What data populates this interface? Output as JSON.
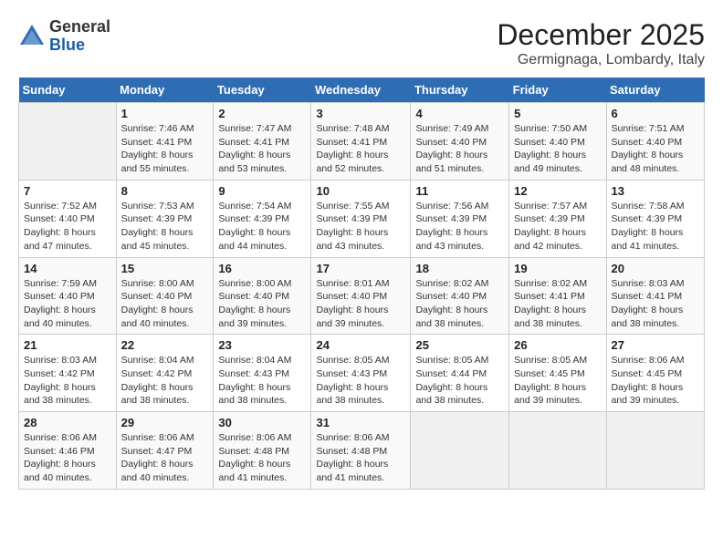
{
  "logo": {
    "general": "General",
    "blue": "Blue"
  },
  "title": "December 2025",
  "subtitle": "Germignaga, Lombardy, Italy",
  "days_header": [
    "Sunday",
    "Monday",
    "Tuesday",
    "Wednesday",
    "Thursday",
    "Friday",
    "Saturday"
  ],
  "weeks": [
    [
      {
        "day": "",
        "info": ""
      },
      {
        "day": "1",
        "info": "Sunrise: 7:46 AM\nSunset: 4:41 PM\nDaylight: 8 hours\nand 55 minutes."
      },
      {
        "day": "2",
        "info": "Sunrise: 7:47 AM\nSunset: 4:41 PM\nDaylight: 8 hours\nand 53 minutes."
      },
      {
        "day": "3",
        "info": "Sunrise: 7:48 AM\nSunset: 4:41 PM\nDaylight: 8 hours\nand 52 minutes."
      },
      {
        "day": "4",
        "info": "Sunrise: 7:49 AM\nSunset: 4:40 PM\nDaylight: 8 hours\nand 51 minutes."
      },
      {
        "day": "5",
        "info": "Sunrise: 7:50 AM\nSunset: 4:40 PM\nDaylight: 8 hours\nand 49 minutes."
      },
      {
        "day": "6",
        "info": "Sunrise: 7:51 AM\nSunset: 4:40 PM\nDaylight: 8 hours\nand 48 minutes."
      }
    ],
    [
      {
        "day": "7",
        "info": "Sunrise: 7:52 AM\nSunset: 4:40 PM\nDaylight: 8 hours\nand 47 minutes."
      },
      {
        "day": "8",
        "info": "Sunrise: 7:53 AM\nSunset: 4:39 PM\nDaylight: 8 hours\nand 45 minutes."
      },
      {
        "day": "9",
        "info": "Sunrise: 7:54 AM\nSunset: 4:39 PM\nDaylight: 8 hours\nand 44 minutes."
      },
      {
        "day": "10",
        "info": "Sunrise: 7:55 AM\nSunset: 4:39 PM\nDaylight: 8 hours\nand 43 minutes."
      },
      {
        "day": "11",
        "info": "Sunrise: 7:56 AM\nSunset: 4:39 PM\nDaylight: 8 hours\nand 43 minutes."
      },
      {
        "day": "12",
        "info": "Sunrise: 7:57 AM\nSunset: 4:39 PM\nDaylight: 8 hours\nand 42 minutes."
      },
      {
        "day": "13",
        "info": "Sunrise: 7:58 AM\nSunset: 4:39 PM\nDaylight: 8 hours\nand 41 minutes."
      }
    ],
    [
      {
        "day": "14",
        "info": "Sunrise: 7:59 AM\nSunset: 4:40 PM\nDaylight: 8 hours\nand 40 minutes."
      },
      {
        "day": "15",
        "info": "Sunrise: 8:00 AM\nSunset: 4:40 PM\nDaylight: 8 hours\nand 40 minutes."
      },
      {
        "day": "16",
        "info": "Sunrise: 8:00 AM\nSunset: 4:40 PM\nDaylight: 8 hours\nand 39 minutes."
      },
      {
        "day": "17",
        "info": "Sunrise: 8:01 AM\nSunset: 4:40 PM\nDaylight: 8 hours\nand 39 minutes."
      },
      {
        "day": "18",
        "info": "Sunrise: 8:02 AM\nSunset: 4:40 PM\nDaylight: 8 hours\nand 38 minutes."
      },
      {
        "day": "19",
        "info": "Sunrise: 8:02 AM\nSunset: 4:41 PM\nDaylight: 8 hours\nand 38 minutes."
      },
      {
        "day": "20",
        "info": "Sunrise: 8:03 AM\nSunset: 4:41 PM\nDaylight: 8 hours\nand 38 minutes."
      }
    ],
    [
      {
        "day": "21",
        "info": "Sunrise: 8:03 AM\nSunset: 4:42 PM\nDaylight: 8 hours\nand 38 minutes."
      },
      {
        "day": "22",
        "info": "Sunrise: 8:04 AM\nSunset: 4:42 PM\nDaylight: 8 hours\nand 38 minutes."
      },
      {
        "day": "23",
        "info": "Sunrise: 8:04 AM\nSunset: 4:43 PM\nDaylight: 8 hours\nand 38 minutes."
      },
      {
        "day": "24",
        "info": "Sunrise: 8:05 AM\nSunset: 4:43 PM\nDaylight: 8 hours\nand 38 minutes."
      },
      {
        "day": "25",
        "info": "Sunrise: 8:05 AM\nSunset: 4:44 PM\nDaylight: 8 hours\nand 38 minutes."
      },
      {
        "day": "26",
        "info": "Sunrise: 8:05 AM\nSunset: 4:45 PM\nDaylight: 8 hours\nand 39 minutes."
      },
      {
        "day": "27",
        "info": "Sunrise: 8:06 AM\nSunset: 4:45 PM\nDaylight: 8 hours\nand 39 minutes."
      }
    ],
    [
      {
        "day": "28",
        "info": "Sunrise: 8:06 AM\nSunset: 4:46 PM\nDaylight: 8 hours\nand 40 minutes."
      },
      {
        "day": "29",
        "info": "Sunrise: 8:06 AM\nSunset: 4:47 PM\nDaylight: 8 hours\nand 40 minutes."
      },
      {
        "day": "30",
        "info": "Sunrise: 8:06 AM\nSunset: 4:48 PM\nDaylight: 8 hours\nand 41 minutes."
      },
      {
        "day": "31",
        "info": "Sunrise: 8:06 AM\nSunset: 4:48 PM\nDaylight: 8 hours\nand 41 minutes."
      },
      {
        "day": "",
        "info": ""
      },
      {
        "day": "",
        "info": ""
      },
      {
        "day": "",
        "info": ""
      }
    ]
  ]
}
